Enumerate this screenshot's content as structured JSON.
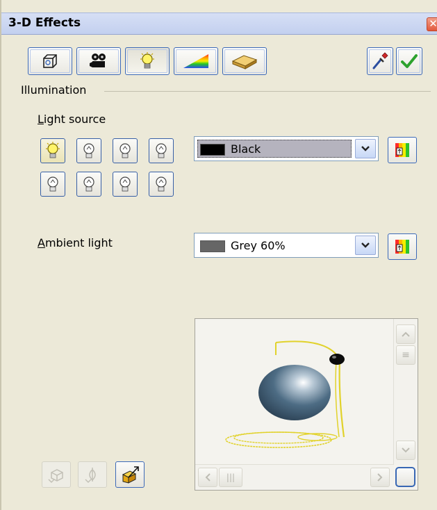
{
  "window": {
    "title": "3-D Effects",
    "close_symbol": "✕"
  },
  "toolbar": {
    "buttons": [
      {
        "icon": "geometry-icon"
      },
      {
        "icon": "shading-icon"
      },
      {
        "icon": "illumination-icon",
        "pressed": true
      },
      {
        "icon": "textures-icon"
      },
      {
        "icon": "material-icon"
      }
    ],
    "right_buttons": [
      {
        "icon": "pipette-icon"
      },
      {
        "icon": "apply-checkmark-icon"
      }
    ]
  },
  "illumination": {
    "section_label": "Illumination",
    "light_source": {
      "label_access_char": "L",
      "label_rest": "ight source",
      "selected_light": 1,
      "color": {
        "value": "Black",
        "swatch": "#000000"
      }
    },
    "ambient_light": {
      "label_access_char": "A",
      "label_rest": "mbient light",
      "color": {
        "value": "Grey 60%",
        "swatch": "#666666"
      }
    }
  },
  "bottom_buttons": [
    {
      "icon": "convert-to-3d-icon",
      "enabled": false
    },
    {
      "icon": "convert-to-lathe-icon",
      "enabled": false
    },
    {
      "icon": "perspective-icon",
      "enabled": true
    }
  ],
  "preview": {
    "scroll_h_grip": "|||",
    "scroll_v_grip": "≡"
  }
}
